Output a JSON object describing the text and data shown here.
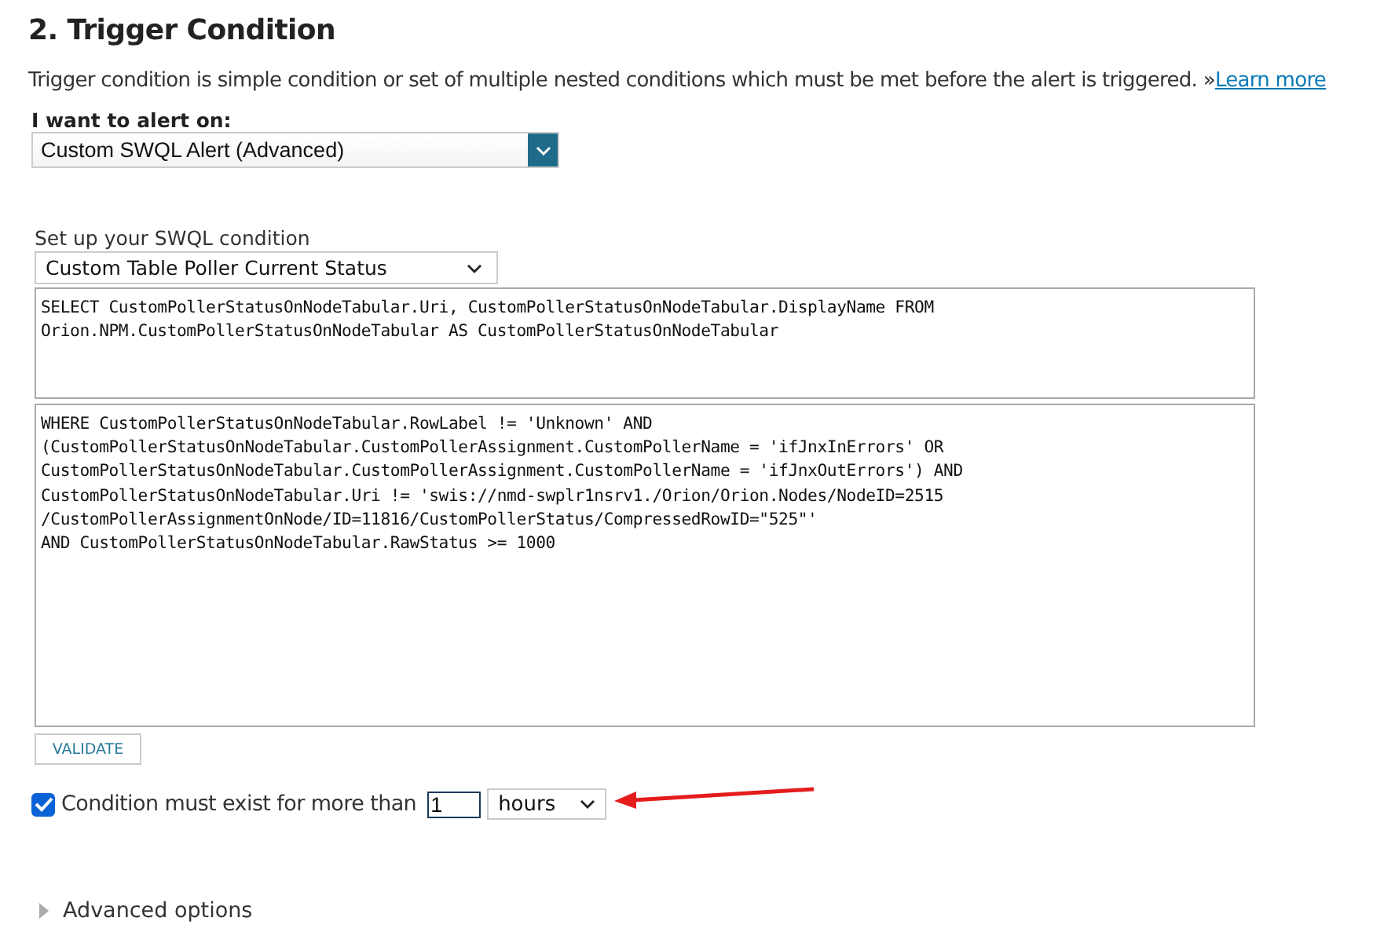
{
  "heading": "2. Trigger Condition",
  "description": "Trigger condition is simple condition or set of multiple nested conditions which must be met before the alert is triggered. »",
  "learn_more": "Learn more",
  "alert_on": {
    "label": "I want to alert on:",
    "value": "Custom SWQL Alert (Advanced)"
  },
  "swql": {
    "label": "Set up your SWQL condition",
    "value": "Custom Table Poller Current Status"
  },
  "select_query": [
    "SELECT CustomPollerStatusOnNodeTabular.Uri, CustomPollerStatusOnNodeTabular.DisplayName FROM",
    "Orion.NPM.CustomPollerStatusOnNodeTabular AS CustomPollerStatusOnNodeTabular"
  ],
  "where_query": [
    "WHERE CustomPollerStatusOnNodeTabular.RowLabel != 'Unknown' AND",
    "(CustomPollerStatusOnNodeTabular.CustomPollerAssignment.CustomPollerName = 'ifJnxInErrors' OR",
    "CustomPollerStatusOnNodeTabular.CustomPollerAssignment.CustomPollerName = 'ifJnxOutErrors') AND",
    "CustomPollerStatusOnNodeTabular.Uri != 'swis://nmd-swplr1nsrv1./Orion/Orion.Nodes/NodeID=2515",
    "/CustomPollerAssignmentOnNode/ID=11816/CustomPollerStatus/CompressedRowID=\"525\"'",
    "AND CustomPollerStatusOnNodeTabular.RawStatus >= 1000"
  ],
  "validate_button": "VALIDATE",
  "condition": {
    "checked": true,
    "label": "Condition must exist for more than",
    "amount": "1",
    "unit": "hours"
  },
  "advanced": {
    "label": "Advanced options",
    "expanded": false
  }
}
